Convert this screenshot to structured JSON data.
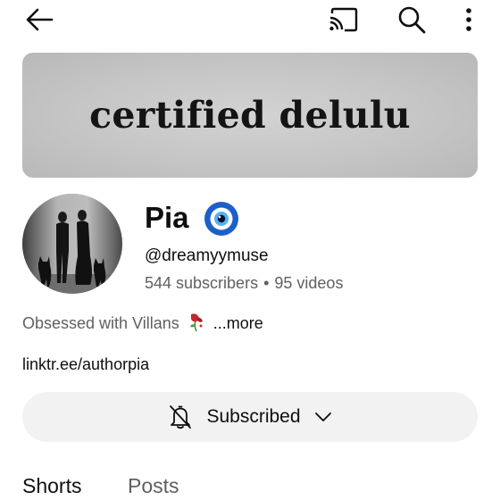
{
  "topbar": {
    "back_icon": "arrow-left-icon",
    "cast_icon": "cast-icon",
    "search_icon": "search-icon",
    "more_icon": "more-vert-icon"
  },
  "banner": {
    "text": "certified delulu"
  },
  "channel": {
    "name": "Pia",
    "badge_icon": "nazar-evil-eye-icon",
    "handle": "@dreamyymuse",
    "subscribers": "544 subscribers",
    "separator": "•",
    "videos": "95 videos"
  },
  "description": {
    "text": "Obsessed with Villans",
    "emoji_icon": "wilted-rose-icon",
    "more": "...more"
  },
  "link": {
    "text": "linktr.ee/authorpia"
  },
  "subscribe": {
    "label": "Subscribed",
    "bell_icon": "bell-off-icon",
    "chevron_icon": "chevron-down-icon"
  },
  "tabs": [
    {
      "label": "Shorts"
    },
    {
      "label": "Posts"
    }
  ],
  "colors": {
    "text_primary": "#0f0f0f",
    "text_secondary": "#606060",
    "button_bg": "#f2f2f2",
    "banner_bg": "#c8c8c8"
  }
}
